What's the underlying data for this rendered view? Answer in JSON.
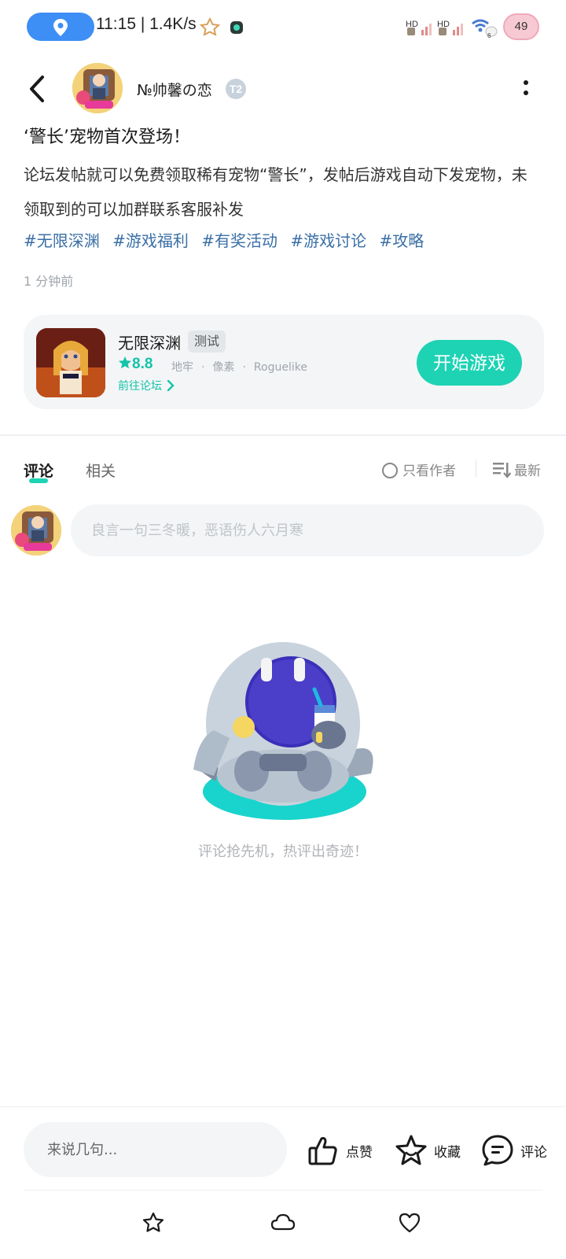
{
  "status_bar": {
    "time_speed": "11:15 | 1.4K/s",
    "battery": "49",
    "icons": [
      "location-icon",
      "star-icon",
      "app-icon",
      "signal-icon",
      "signal-icon",
      "wifi-icon"
    ]
  },
  "header": {
    "author_name": "№帅馨の恋",
    "author_badge": "T2",
    "icons": [
      "back-icon",
      "more-icon"
    ]
  },
  "post": {
    "title": "‘警长’宠物首次登场！",
    "body": "论坛发帖就可以免费领取稀有宠物“警长”，发帖后游戏自动下发宠物，未领取到的可以加群联系客服补发",
    "tags": [
      "#无限深渊",
      "#游戏福利",
      "#有奖活动",
      "#游戏讨论",
      "#攻略"
    ],
    "time_ago": "1 分钟前"
  },
  "game_card": {
    "name": "无限深渊",
    "tag": "测试",
    "score": "8.8",
    "categories": [
      "地牢",
      "像素",
      "Roguelike"
    ],
    "category_separator": "·",
    "forum_link": "前往论坛",
    "play_button": "开始游戏"
  },
  "tabs": {
    "comment": "评论",
    "related": "相关",
    "only_author": "只看作者",
    "sort": "最新"
  },
  "comment_box": {
    "placeholder": "良言一句三冬暖，恶语伤人六月寒"
  },
  "empty_state": {
    "text": "评论抢先机，热评出奇迹！"
  },
  "bottom_bar": {
    "input_placeholder": "来说几句...",
    "like": "点赞",
    "favorite": "收藏",
    "comment": "评论"
  },
  "colors": {
    "accent": "#1dd3b4",
    "tag_link": "#3a6fa6",
    "location_pill": "#3d8ef5"
  }
}
